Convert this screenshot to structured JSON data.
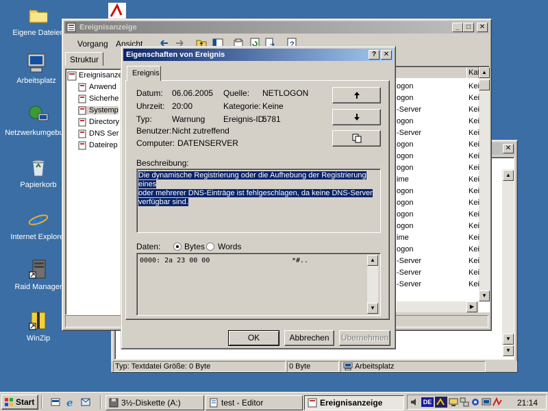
{
  "desktop": {
    "icons": [
      {
        "label": "Eigene Dateien",
        "icon": "folder-icon"
      },
      {
        "label": "Arbeitsplatz",
        "icon": "computer-icon"
      },
      {
        "label": "Netzwerkumgebung",
        "icon": "network-icon"
      },
      {
        "label": "Papierkorb",
        "icon": "recycle-bin-icon"
      },
      {
        "label": "Internet Explorer",
        "icon": "ie-icon"
      },
      {
        "label": "Raid Manager",
        "icon": "raid-icon"
      },
      {
        "label": "WinZip",
        "icon": "winzip-icon"
      }
    ]
  },
  "main_window": {
    "title": "Ereignisanzeige",
    "menu": [
      "Vorgang",
      "Ansicht"
    ],
    "tab": "Struktur",
    "tree": [
      "Ereignisanzeige",
      "Anwend",
      "Sicherhe",
      "Systemp",
      "Directory",
      "DNS Ser",
      "Dateirep"
    ],
    "column_header": "Kat",
    "list_rows": [
      {
        "source": "ogon",
        "cat": "Kei"
      },
      {
        "source": "ogon",
        "cat": "Kei"
      },
      {
        "source": "-Server",
        "cat": "Kei"
      },
      {
        "source": "ogon",
        "cat": "Kei"
      },
      {
        "source": "-Server",
        "cat": "Kei"
      },
      {
        "source": "ogon",
        "cat": "Kei"
      },
      {
        "source": "ogon",
        "cat": "Kei"
      },
      {
        "source": "ogon",
        "cat": "Kei"
      },
      {
        "source": "ime",
        "cat": "Kei"
      },
      {
        "source": "ogon",
        "cat": "Kei"
      },
      {
        "source": "ogon",
        "cat": "Kei"
      },
      {
        "source": "ogon",
        "cat": "Kei"
      },
      {
        "source": "ogon",
        "cat": "Kei"
      },
      {
        "source": "ime",
        "cat": "Kei"
      },
      {
        "source": "ogon",
        "cat": "Kei"
      },
      {
        "source": "-Server",
        "cat": "Kei"
      },
      {
        "source": "-Server",
        "cat": "Kei"
      },
      {
        "source": "-Server",
        "cat": "Kei"
      }
    ]
  },
  "back_window": {
    "status_text": "Typ: Textdatei Größe: 0 Byte",
    "status_size": "0 Byte",
    "status_location": "Arbeitsplatz"
  },
  "dialog": {
    "title": "Eigenschaften von Ereignis",
    "help_label": "?",
    "close_label": "✕",
    "tab": "Ereignis",
    "fields": {
      "datum_label": "Datum:",
      "datum": "06.06.2005",
      "quelle_label": "Quelle:",
      "quelle": "NETLOGON",
      "uhrzeit_label": "Uhrzeit:",
      "uhrzeit": "20:00",
      "kategorie_label": "Kategorie:",
      "kategorie": "Keine",
      "typ_label": "Typ:",
      "typ": "Warnung",
      "ereignis_id_label": "Ereignis-ID:",
      "ereignis_id": "5781",
      "benutzer_label": "Benutzer:",
      "benutzer": "Nicht zutreffend",
      "computer_label": "Computer:",
      "computer": "DATENSERVER"
    },
    "beschreibung_label": "Beschreibung:",
    "beschreibung_lines": [
      "Die dynamische Registrierung oder die Aufhebung der Registrierung eines",
      "oder mehrerer DNS-Einträge ist fehlgeschlagen, da keine DNS-Server",
      "verfügbar sind."
    ],
    "daten_label": "Daten:",
    "radio_bytes": "Bytes",
    "radio_words": "Words",
    "daten_line": "0000: 2a 23 00 00",
    "daten_ascii": "*#..",
    "buttons": {
      "ok": "OK",
      "abbrechen": "Abbrechen",
      "uebernehmen": "Übernehmen"
    }
  },
  "taskbar": {
    "start": "Start",
    "tasks": [
      "3½-Diskette (A:)",
      "test - Editor",
      "Ereignisanzeige"
    ],
    "lang": "DE",
    "clock": "21:14"
  }
}
